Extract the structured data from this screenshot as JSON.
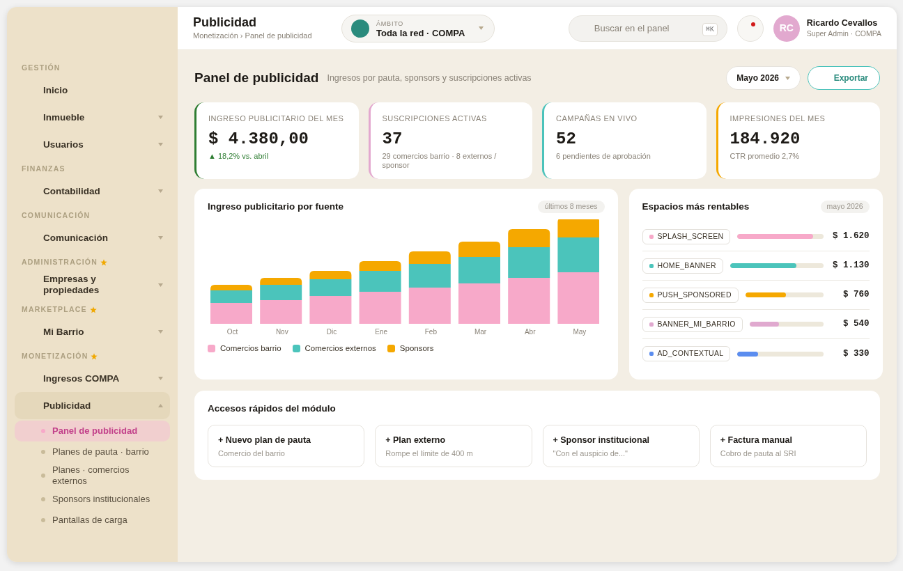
{
  "sidebar": {
    "sections": [
      {
        "title": "GESTIÓN",
        "starred": false,
        "items": [
          {
            "label": "Inicio",
            "kind": "link",
            "selected": false
          },
          {
            "label": "Inmueble",
            "kind": "group",
            "expanded": false,
            "selected": false
          },
          {
            "label": "Usuarios",
            "kind": "group",
            "expanded": false,
            "selected": false
          }
        ]
      },
      {
        "title": "FINANZAS",
        "starred": false,
        "items": [
          {
            "label": "Contabilidad",
            "kind": "group",
            "expanded": false,
            "selected": false
          }
        ]
      },
      {
        "title": "COMUNICACIÓN",
        "starred": false,
        "items": [
          {
            "label": "Comunicación",
            "kind": "group",
            "expanded": false,
            "selected": false
          }
        ]
      },
      {
        "title": "ADMINISTRACIÓN",
        "starred": true,
        "items": [
          {
            "label": "Empresas y propiedades",
            "kind": "group",
            "expanded": false,
            "selected": false
          }
        ]
      },
      {
        "title": "MARKETPLACE",
        "starred": true,
        "items": [
          {
            "label": "Mi Barrio",
            "kind": "group",
            "expanded": false,
            "selected": false
          }
        ]
      },
      {
        "title": "MONETIZACIÓN",
        "starred": true,
        "items": [
          {
            "label": "Ingresos COMPA",
            "kind": "group",
            "expanded": false,
            "selected": false
          },
          {
            "label": "Publicidad",
            "kind": "group",
            "expanded": true,
            "selected": true,
            "children": [
              {
                "label": "Panel de publicidad",
                "selected": true
              },
              {
                "label": "Planes de pauta · barrio",
                "selected": false
              },
              {
                "label": "Planes · comercios externos",
                "selected": false
              },
              {
                "label": "Sponsors institucionales",
                "selected": false
              },
              {
                "label": "Pantallas de carga",
                "selected": false
              }
            ]
          }
        ]
      }
    ]
  },
  "header": {
    "title": "Publicidad",
    "breadcrumb": "Monetización › Panel de publicidad",
    "scope": {
      "label": "ÁMBITO",
      "value": "Toda la red · COMPA"
    },
    "search": {
      "placeholder": "Buscar en el panel",
      "shortcut": "⌘K"
    },
    "notifications": {
      "unread": true
    },
    "user": {
      "initials": "RC",
      "name": "Ricardo Cevallos",
      "role": "Super Admin · COMPA"
    }
  },
  "page": {
    "title": "Panel de publicidad",
    "subtitle": "Ingresos por pauta, sponsors y suscripciones activas",
    "period": "Mayo 2026",
    "export": "Exportar"
  },
  "kpis": [
    {
      "label": "INGRESO PUBLICITARIO DEL MES",
      "value": "$ 4.380,00",
      "sub": "▲ 18,2% vs. abril",
      "kind": "trend",
      "color": "#2e7d32"
    },
    {
      "label": "SUSCRIPCIONES ACTIVAS",
      "value": "37",
      "sub": "29 comercios barrio · 8 externos / sponsor",
      "kind": "note",
      "color": "#e3a8cf"
    },
    {
      "label": "CAMPAÑAS EN VIVO",
      "value": "52",
      "sub": "6 pendientes de aprobación",
      "kind": "note",
      "color": "#4cc3bb"
    },
    {
      "label": "IMPRESIONES DEL MES",
      "value": "184.920",
      "sub": "CTR promedio 2,7%",
      "kind": "note",
      "color": "#f5a800"
    }
  ],
  "revenue_chart": {
    "title": "Ingreso publicitario por fuente",
    "badge": "últimos 8 meses",
    "months": [
      "Oct",
      "Nov",
      "Dic",
      "Ene",
      "Feb",
      "Mar",
      "Abr",
      "May"
    ],
    "legend": [
      {
        "label": "Comercios barrio",
        "color": "#f7a9c9"
      },
      {
        "label": "Comercios externos",
        "color": "#4bc4bb"
      },
      {
        "label": "Sponsors",
        "color": "#f5a800"
      }
    ]
  },
  "spaces": {
    "title": "Espacios más rentables",
    "badge": "mayo 2026",
    "items": [
      {
        "name": "SPLASH_SCREEN",
        "color": "#f7a9c9",
        "level": 0.88,
        "value": "$ 1.620"
      },
      {
        "name": "HOME_BANNER",
        "color": "#4bc4bb",
        "level": 0.71,
        "value": "$ 1.130"
      },
      {
        "name": "PUSH_SPONSORED",
        "color": "#f5a800",
        "level": 0.52,
        "value": "$ 760"
      },
      {
        "name": "BANNER_MI_BARRIO",
        "color": "#e0a9cf",
        "level": 0.4,
        "value": "$ 540"
      },
      {
        "name": "AD_CONTEXTUAL",
        "color": "#5b8def",
        "level": 0.24,
        "value": "$ 330"
      }
    ]
  },
  "quick_access": {
    "title": "Accesos rápidos del módulo",
    "items": [
      {
        "title": "+ Nuevo plan de pauta",
        "subtitle": "Comercio del barrio"
      },
      {
        "title": "+ Plan externo",
        "subtitle": "Rompe el límite de 400 m"
      },
      {
        "title": "+ Sponsor institucional",
        "subtitle": "\"Con el auspicio de...\""
      },
      {
        "title": "+ Factura manual",
        "subtitle": "Cobro de pauta al SRI"
      }
    ]
  }
}
